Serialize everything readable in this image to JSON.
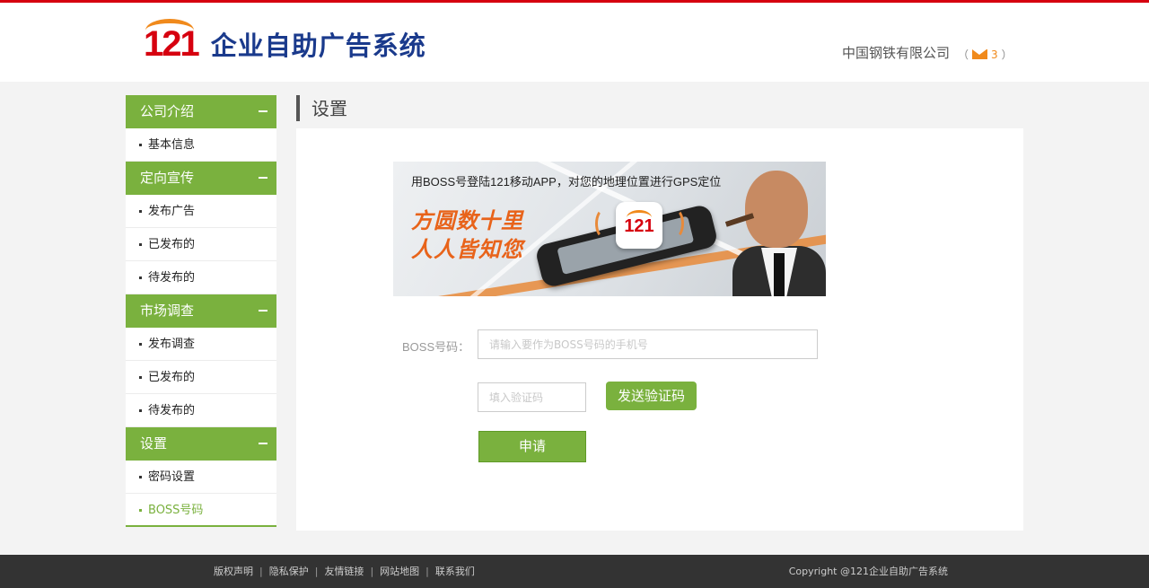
{
  "header": {
    "logo_number": "121",
    "logo_title": "企业自助广告系统",
    "company_name": "中国钢铁有限公司",
    "mail_open": "（",
    "mail_count": "3",
    "mail_close": "）"
  },
  "sidebar": {
    "groups": [
      {
        "title": "公司介绍",
        "items": [
          "基本信息"
        ]
      },
      {
        "title": "定向宣传",
        "items": [
          "发布广告",
          "已发布的",
          "待发布的"
        ]
      },
      {
        "title": "市场调查",
        "items": [
          "发布调查",
          "已发布的",
          "待发布的"
        ]
      },
      {
        "title": "设置",
        "items": [
          "密码设置",
          "BOSS号码"
        ]
      }
    ],
    "active_item": "BOSS号码"
  },
  "main": {
    "title": "设置",
    "banner": {
      "caption": "用BOSS号登陆121移动APP，对您的地理位置进行GPS定位",
      "slogan_line1": "方圆数十里",
      "slogan_line2": "人人皆知您",
      "app_label": "121"
    },
    "form": {
      "boss_label": "BOSS号码：",
      "boss_placeholder": "请输入要作为BOSS号码的手机号",
      "boss_value": "",
      "code_placeholder": "填入验证码",
      "code_value": "",
      "send_code_button": "发送验证码",
      "submit_button": "申请"
    }
  },
  "footer": {
    "links": [
      "版权声明",
      "隐私保护",
      "友情链接",
      "网站地图",
      "联系我们"
    ],
    "separator": "|",
    "copyright": "Copyright @121企业自助广告系统"
  },
  "colors": {
    "accent_green": "#7ab13e",
    "top_red": "#d6000f",
    "logo_orange": "#f08a1c",
    "logo_blue": "#1a3a8c",
    "footer_bg": "#333333"
  }
}
